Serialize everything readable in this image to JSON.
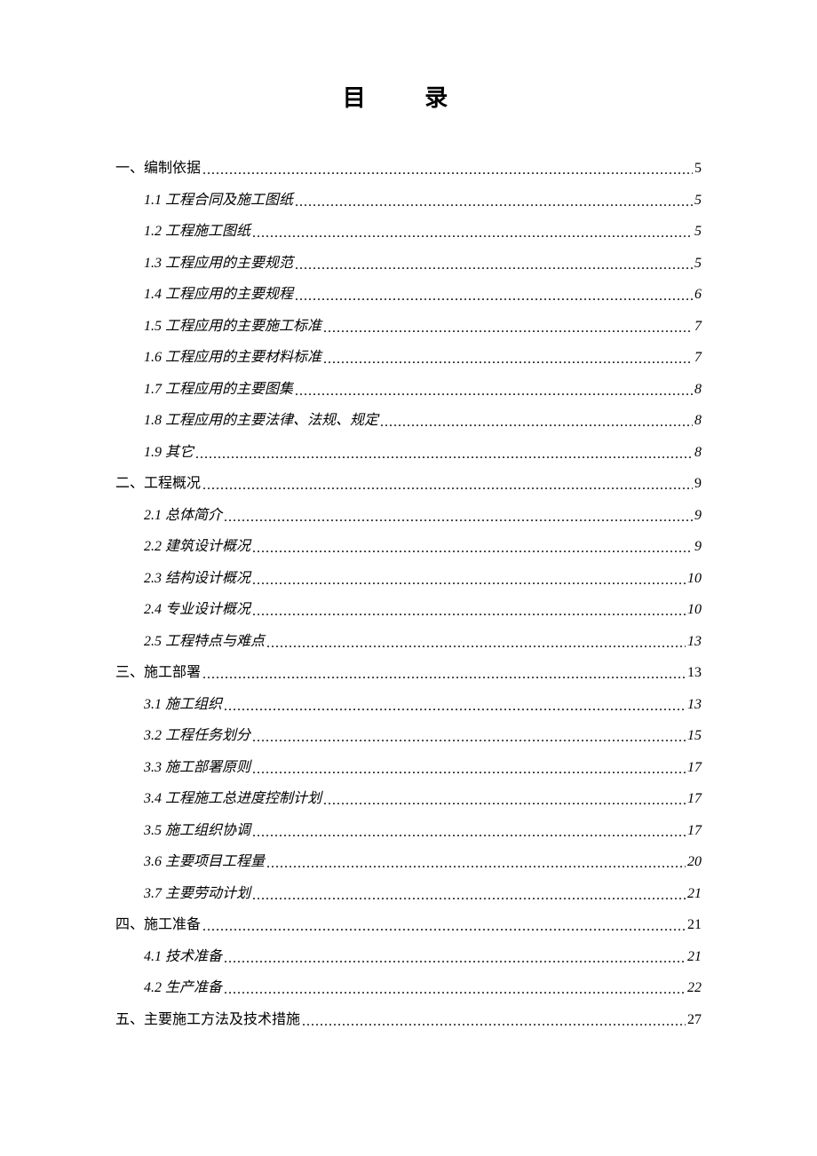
{
  "title": "目  录",
  "toc": [
    {
      "level": 1,
      "label": "一、编制依据",
      "page": "5"
    },
    {
      "level": 2,
      "label": "1.1 工程合同及施工图纸",
      "page": "5"
    },
    {
      "level": 2,
      "label": "1.2 工程施工图纸",
      "page": "5"
    },
    {
      "level": 2,
      "label": "1.3 工程应用的主要规范",
      "page": "5"
    },
    {
      "level": 2,
      "label": "1.4 工程应用的主要规程",
      "page": "6"
    },
    {
      "level": 2,
      "label": "1.5 工程应用的主要施工标准",
      "page": "7"
    },
    {
      "level": 2,
      "label": "1.6 工程应用的主要材料标准",
      "page": "7"
    },
    {
      "level": 2,
      "label": "1.7 工程应用的主要图集",
      "page": "8"
    },
    {
      "level": 2,
      "label": "1.8 工程应用的主要法律、法规、规定",
      "page": "8"
    },
    {
      "level": 2,
      "label": "1.9 其它",
      "page": "8"
    },
    {
      "level": 1,
      "label": "二、工程概况",
      "page": "9"
    },
    {
      "level": 2,
      "label": "2.1 总体简介",
      "page": "9"
    },
    {
      "level": 2,
      "label": "2.2 建筑设计概况",
      "page": "9"
    },
    {
      "level": 2,
      "label": "2.3 结构设计概况",
      "page": "10"
    },
    {
      "level": 2,
      "label": "2.4 专业设计概况",
      "page": "10"
    },
    {
      "level": 2,
      "label": "2.5 工程特点与难点",
      "page": "13"
    },
    {
      "level": 1,
      "label": "三、施工部署",
      "page": "13"
    },
    {
      "level": 2,
      "label": "3.1 施工组织",
      "page": "13"
    },
    {
      "level": 2,
      "label": "3.2 工程任务划分",
      "page": "15"
    },
    {
      "level": 2,
      "label": "3.3 施工部署原则",
      "page": "17"
    },
    {
      "level": 2,
      "label": "3.4 工程施工总进度控制计划",
      "page": "17"
    },
    {
      "level": 2,
      "label": "3.5 施工组织协调",
      "page": "17"
    },
    {
      "level": 2,
      "label": "3.6 主要项目工程量",
      "page": "20"
    },
    {
      "level": 2,
      "label": "3.7 主要劳动计划",
      "page": "21"
    },
    {
      "level": 1,
      "label": "四、施工准备",
      "page": "21"
    },
    {
      "level": 2,
      "label": "4.1 技术准备",
      "page": "21"
    },
    {
      "level": 2,
      "label": "4.2 生产准备",
      "page": "22"
    },
    {
      "level": 1,
      "label": "五、主要施工方法及技术措施",
      "page": "27"
    }
  ]
}
